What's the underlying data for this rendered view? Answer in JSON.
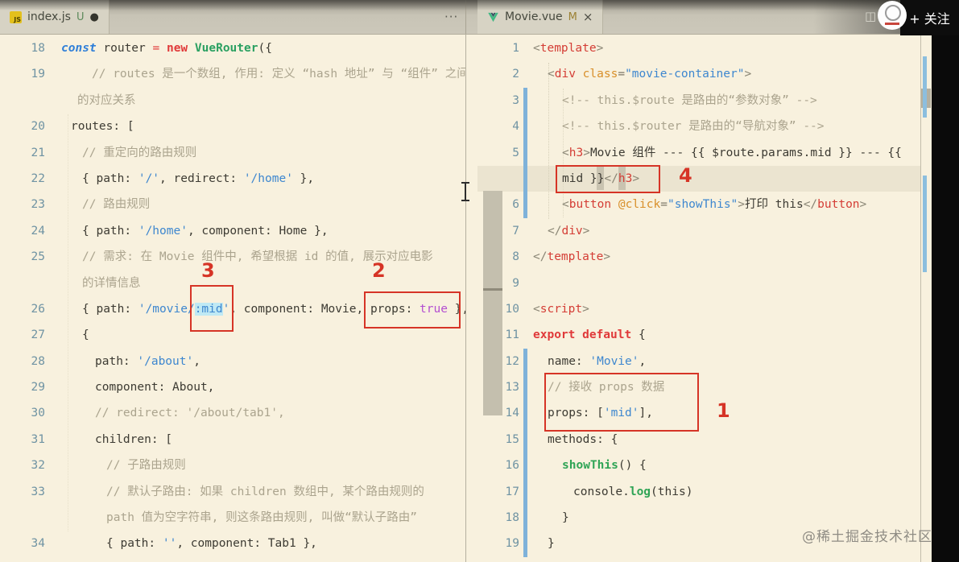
{
  "tabs": {
    "left": {
      "file": "index.js",
      "git": "U",
      "dirty": "●",
      "actions": "···"
    },
    "right": {
      "file": "Movie.vue",
      "git": "M",
      "close": "×"
    }
  },
  "icons": {
    "js_badge": "JS",
    "split_editor": "◫"
  },
  "overlay": {
    "follow_label": "+ 关注"
  },
  "watermark": "@稀土掘金技术社区",
  "annotations": {
    "label1": "1",
    "label2": "2",
    "label3": "3",
    "label4": "4"
  },
  "left_pane": {
    "lines": [
      {
        "n": "18",
        "ind": 0,
        "toks": [
          [
            "kc",
            "const"
          ],
          [
            "pl",
            " router "
          ],
          [
            "op",
            "="
          ],
          [
            "pl",
            " "
          ],
          [
            "kr",
            "new"
          ],
          [
            "pl",
            " "
          ],
          [
            "cl",
            "VueRouter"
          ],
          [
            "pl",
            "({"
          ]
        ]
      },
      {
        "n": "19",
        "ind": 38,
        "toks": [
          [
            "cmt",
            "// routes 是一个数组, 作用: 定义 “hash 地址” 与 “组件” 之间"
          ]
        ]
      },
      {
        "n": "",
        "ind": 20,
        "toks": [
          [
            "cmt",
            "的对应关系"
          ]
        ]
      },
      {
        "n": "20",
        "ind": 12,
        "toks": [
          [
            "pl",
            "routes: ["
          ]
        ]
      },
      {
        "n": "21",
        "ind": 26,
        "toks": [
          [
            "cmt",
            "// 重定向的路由规则"
          ]
        ]
      },
      {
        "n": "22",
        "ind": 26,
        "toks": [
          [
            "pl",
            "{ path: "
          ],
          [
            "str",
            "'/'"
          ],
          [
            "pl",
            ", redirect: "
          ],
          [
            "str",
            "'/home'"
          ],
          [
            "pl",
            " },"
          ]
        ]
      },
      {
        "n": "23",
        "ind": 26,
        "toks": [
          [
            "cmt",
            "// 路由规则"
          ]
        ]
      },
      {
        "n": "24",
        "ind": 26,
        "toks": [
          [
            "pl",
            "{ path: "
          ],
          [
            "str",
            "'/home'"
          ],
          [
            "pl",
            ", component: Home },"
          ]
        ]
      },
      {
        "n": "25",
        "ind": 26,
        "toks": [
          [
            "cmt",
            "// 需求: 在 Movie 组件中, 希望根据 id 的值, 展示对应电影"
          ]
        ]
      },
      {
        "n": "",
        "ind": 26,
        "toks": [
          [
            "cmt",
            "的详情信息"
          ]
        ]
      },
      {
        "n": "26",
        "ind": 26,
        "toks": [
          [
            "pl",
            "{ path: "
          ],
          [
            "str",
            "'/movie/"
          ],
          [
            "hlm",
            ":mid"
          ],
          [
            "str",
            "'"
          ],
          [
            "pl",
            ", component: Movie, props: "
          ],
          [
            "bool",
            "true"
          ],
          [
            "pl",
            " },"
          ]
        ]
      },
      {
        "n": "27",
        "ind": 26,
        "toks": [
          [
            "pl",
            "{"
          ]
        ]
      },
      {
        "n": "28",
        "ind": 42,
        "toks": [
          [
            "pl",
            "path: "
          ],
          [
            "str",
            "'/about'"
          ],
          [
            "pl",
            ","
          ]
        ]
      },
      {
        "n": "29",
        "ind": 42,
        "toks": [
          [
            "pl",
            "component: About,"
          ]
        ]
      },
      {
        "n": "30",
        "ind": 42,
        "toks": [
          [
            "cmt",
            "// redirect: '/about/tab1',"
          ]
        ]
      },
      {
        "n": "31",
        "ind": 42,
        "toks": [
          [
            "pl",
            "children: ["
          ]
        ]
      },
      {
        "n": "32",
        "ind": 56,
        "toks": [
          [
            "cmt",
            "// 子路由规则"
          ]
        ]
      },
      {
        "n": "33",
        "ind": 56,
        "toks": [
          [
            "cmt",
            "// 默认子路由: 如果 children 数组中, 某个路由规则的"
          ]
        ]
      },
      {
        "n": "",
        "ind": 56,
        "toks": [
          [
            "cmt",
            "path 值为空字符串, 则这条路由规则, 叫做“默认子路由”"
          ]
        ]
      },
      {
        "n": "34",
        "ind": 56,
        "toks": [
          [
            "pl",
            "{ path: "
          ],
          [
            "str",
            "''"
          ],
          [
            "pl",
            ", component: Tab1 },"
          ]
        ]
      }
    ]
  },
  "right_pane": {
    "lines": [
      {
        "n": "1",
        "ind": 0,
        "toks": [
          [
            "br",
            "<"
          ],
          [
            "tag",
            "template"
          ],
          [
            "br",
            ">"
          ]
        ]
      },
      {
        "n": "2",
        "ind": 18,
        "toks": [
          [
            "br",
            "<"
          ],
          [
            "tag",
            "div"
          ],
          [
            "pl",
            " "
          ],
          [
            "attr",
            "class"
          ],
          [
            "op2",
            "="
          ],
          [
            "str",
            "\"movie-container\""
          ],
          [
            "br",
            ">"
          ]
        ]
      },
      {
        "n": "3",
        "ind": 36,
        "toks": [
          [
            "cmt",
            "<!-- this.$route 是路由的“参数对象” -->"
          ]
        ]
      },
      {
        "n": "4",
        "ind": 36,
        "toks": [
          [
            "cmt",
            "<!-- this.$router 是路由的“导航对象” -->"
          ]
        ]
      },
      {
        "n": "5",
        "ind": 36,
        "toks": [
          [
            "br",
            "<"
          ],
          [
            "tag",
            "h3"
          ],
          [
            "br",
            ">"
          ],
          [
            "pl",
            "Movie 组件 --- {{ $route.params.mid }} --- {{"
          ]
        ]
      },
      {
        "n": "",
        "ind": 36,
        "toks": [
          [
            "pl",
            "mid }}"
          ],
          [
            "br",
            "</"
          ],
          [
            "tag",
            "h3"
          ],
          [
            "br",
            ">"
          ]
        ]
      },
      {
        "n": "6",
        "ind": 36,
        "toks": [
          [
            "br",
            "<"
          ],
          [
            "tag",
            "button"
          ],
          [
            "pl",
            " "
          ],
          [
            "attr",
            "@click"
          ],
          [
            "op2",
            "="
          ],
          [
            "str",
            "\"showThis\""
          ],
          [
            "br",
            ">"
          ],
          [
            "pl",
            "打印 this"
          ],
          [
            "br",
            "</"
          ],
          [
            "tag",
            "button"
          ],
          [
            "br",
            ">"
          ]
        ]
      },
      {
        "n": "7",
        "ind": 18,
        "toks": [
          [
            "br",
            "</"
          ],
          [
            "tag",
            "div"
          ],
          [
            "br",
            ">"
          ]
        ]
      },
      {
        "n": "8",
        "ind": 0,
        "toks": [
          [
            "br",
            "</"
          ],
          [
            "tag",
            "template"
          ],
          [
            "br",
            ">"
          ]
        ]
      },
      {
        "n": "9",
        "ind": 0,
        "toks": []
      },
      {
        "n": "10",
        "ind": 0,
        "toks": [
          [
            "br",
            "<"
          ],
          [
            "tag",
            "script"
          ],
          [
            "br",
            ">"
          ]
        ]
      },
      {
        "n": "11",
        "ind": 0,
        "toks": [
          [
            "kr",
            "export default"
          ],
          [
            "pl",
            " {"
          ]
        ]
      },
      {
        "n": "12",
        "ind": 18,
        "toks": [
          [
            "pl",
            "name: "
          ],
          [
            "str",
            "'Movie'"
          ],
          [
            "pl",
            ","
          ]
        ]
      },
      {
        "n": "13",
        "ind": 18,
        "toks": [
          [
            "cmt",
            "// 接收 props 数据"
          ]
        ]
      },
      {
        "n": "14",
        "ind": 18,
        "toks": [
          [
            "pl",
            "props: ["
          ],
          [
            "str",
            "'mid'"
          ],
          [
            "pl",
            "],"
          ]
        ]
      },
      {
        "n": "15",
        "ind": 18,
        "toks": [
          [
            "pl",
            "methods: {"
          ]
        ]
      },
      {
        "n": "16",
        "ind": 36,
        "toks": [
          [
            "fn",
            "showThis"
          ],
          [
            "pl",
            "() {"
          ]
        ]
      },
      {
        "n": "17",
        "ind": 50,
        "toks": [
          [
            "pl",
            "console."
          ],
          [
            "fn",
            "log"
          ],
          [
            "pl",
            "(this)"
          ]
        ]
      },
      {
        "n": "18",
        "ind": 36,
        "toks": [
          [
            "pl",
            "}"
          ]
        ]
      },
      {
        "n": "19",
        "ind": 18,
        "toks": [
          [
            "pl",
            "}"
          ]
        ]
      }
    ]
  }
}
